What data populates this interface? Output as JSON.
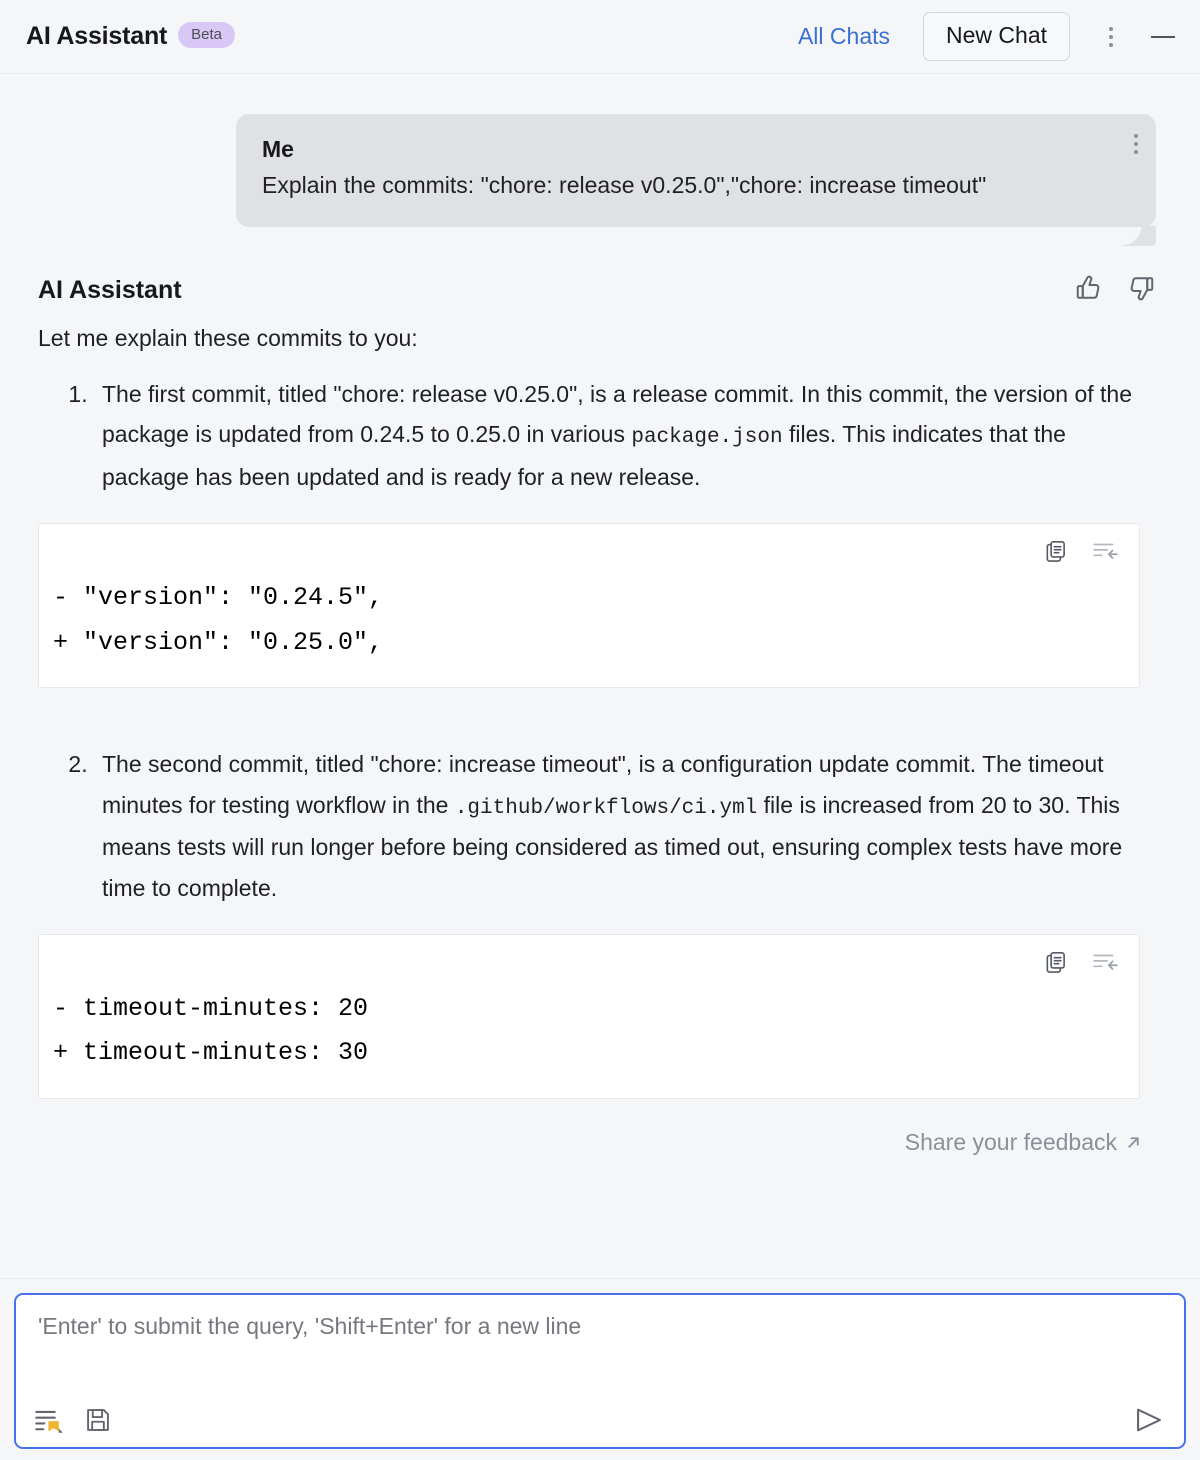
{
  "header": {
    "title": "AI Assistant",
    "badge": "Beta",
    "all_chats": "All Chats",
    "new_chat": "New Chat",
    "kebab_icon": "more-vertical-icon",
    "minimize_icon": "minimize-icon"
  },
  "user_message": {
    "author": "Me",
    "text": "Explain the commits: \"chore: release v0.25.0\",\"chore: increase timeout\"",
    "kebab_icon": "more-vertical-icon"
  },
  "assistant": {
    "name": "AI Assistant",
    "intro": "Let me explain these commits to you:",
    "thumbs_up_icon": "thumbs-up-icon",
    "thumbs_down_icon": "thumbs-down-icon",
    "points": [
      {
        "before": "The first commit, titled \"chore: release v0.25.0\", is a release commit. In this commit, the version of the package is updated from 0.24.5 to 0.25.0 in various ",
        "code": "package.json",
        "after": " files. This indicates that the package has been updated and is ready for a new release."
      },
      {
        "before": "The second commit, titled \"chore: increase timeout\", is a configuration update commit. The timeout minutes for testing workflow in the ",
        "code": ".github/workflows/ci.yml",
        "after": " file is increased from 20 to 30. This means tests will run longer before being considered as timed out, ensuring complex tests have more time to complete."
      }
    ],
    "code_blocks": [
      {
        "copy_icon": "copy-icon",
        "insert_icon": "insert-into-editor-icon",
        "lines": [
          "- \"version\": \"0.24.5\",",
          "+ \"version\": \"0.25.0\","
        ]
      },
      {
        "copy_icon": "copy-icon",
        "insert_icon": "insert-into-editor-icon",
        "lines": [
          "- timeout-minutes: 20",
          "+ timeout-minutes: 30"
        ]
      }
    ],
    "feedback_label": "Share your feedback",
    "feedback_icon": "external-link-arrow-icon"
  },
  "input": {
    "placeholder": "'Enter' to submit the query, 'Shift+Enter' for a new line",
    "value": "",
    "attach_context_icon": "attach-context-icon",
    "save_icon": "save-floppy-icon",
    "send_icon": "send-icon"
  },
  "colors": {
    "page_bg": "#f5f6f8",
    "accent_link": "#3b6fd4",
    "badge_bg": "#d9c8f5",
    "bubble_bg": "#e0e1e5",
    "input_border": "#4971e8",
    "muted_text": "#8c8f99",
    "attach_badge": "#f0b433"
  }
}
